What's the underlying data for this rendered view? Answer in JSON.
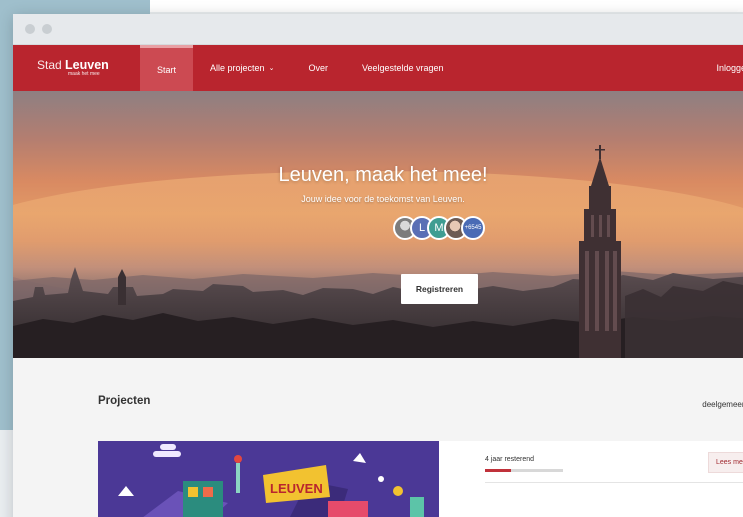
{
  "brand": {
    "name_light": "Stad",
    "name_bold": "Leuven",
    "tagline": "maak het mee"
  },
  "nav": {
    "items": [
      {
        "label": "Start",
        "active": true
      },
      {
        "label": "Alle projecten",
        "dropdown": true
      },
      {
        "label": "Over"
      },
      {
        "label": "Veelgestelde vragen"
      }
    ],
    "login_label": "Inloggen"
  },
  "hero": {
    "title": "Leuven, maak het mee!",
    "subtitle": "Jouw idee voor de toekomst van Leuven.",
    "avatars": [
      "",
      "L",
      "M",
      ""
    ],
    "avatar_count": "+6545",
    "register_label": "Registreren"
  },
  "projects": {
    "title": "Projecten",
    "filter_label": "deelgemeente",
    "cards": [
      {
        "image_text": "LEUVEN",
        "remaining": "4 jaar resterend",
        "progress": 0.33,
        "read_more": "Lees meer"
      }
    ]
  },
  "colors": {
    "brand_red": "#b9252e",
    "active_tab": "#cc4a52",
    "card_image_bg": "#4b3896"
  }
}
